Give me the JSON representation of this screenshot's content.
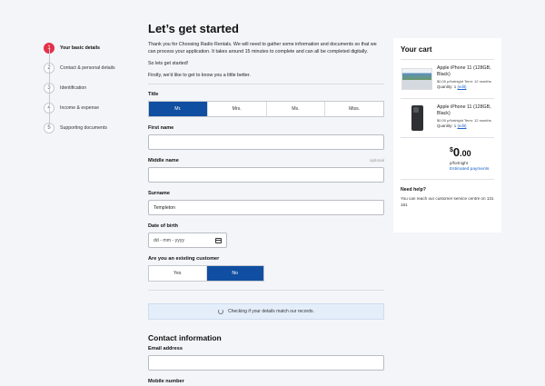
{
  "stepper": {
    "steps": [
      {
        "num": "1",
        "label": "Your basic details"
      },
      {
        "num": "2",
        "label": "Contact & personal details"
      },
      {
        "num": "3",
        "label": "Identification"
      },
      {
        "num": "4",
        "label": "Income & expense"
      },
      {
        "num": "5",
        "label": "Supporting documents"
      }
    ],
    "active_step": "1"
  },
  "main": {
    "heading": "Let’s get started",
    "intro1": "Thank you for Choosing Radio Rentals. We will need to gather some information and documents so that we can process your application. It takes around 15 minutes to complete and can all be completed digitally.",
    "intro2": "So lets get started!",
    "intro3": "Firstly, we'd like to get to know you a little better.",
    "title_label": "Title",
    "titles": [
      "Mr.",
      "Mrs.",
      "Ms.",
      "Miss."
    ],
    "title_selected": "Mr.",
    "first_name_label": "First name",
    "first_name_value": "",
    "middle_name_label": "Middle name",
    "optional_label": "optional",
    "middle_name_value": "",
    "surname_label": "Surname",
    "surname_value": "Templeton",
    "dob_label": "Date of birth",
    "dob_placeholder": "dd - mm - yyyy",
    "existing_label": "Are you an existing customer",
    "yes_label": "Yes",
    "no_label": "No",
    "existing_selected": "No",
    "notice": "Checking if your details match our records.",
    "contact_heading": "Contact information",
    "email_label": "Email address",
    "email_value": "",
    "mobile_label": "Mobile number"
  },
  "cart": {
    "title": "Your cart",
    "items": [
      {
        "name": "Apple iPhone 11 (128GB, Black)",
        "term": "$0.00 p/fortnight Term: 12 months",
        "qty_label": "Quantity: 1",
        "edit": "(edit)"
      },
      {
        "name": "Apple iPhone 11 (128GB, Black)",
        "term": "$0.00 p/fortnight Term: 12 months",
        "qty_label": "Quantity: 1",
        "edit": "(edit)"
      }
    ],
    "currency": "$",
    "price_dollars": "0",
    "price_cents": ".00",
    "per": "p/fortnight",
    "estimated": "Estimated payments",
    "help_title": "Need help?",
    "help_text": "You can reach our customer service centre on 131 181"
  },
  "colors": {
    "accent": "#0f4ea1",
    "step_active": "#e4304a",
    "link": "#1a63c9"
  }
}
